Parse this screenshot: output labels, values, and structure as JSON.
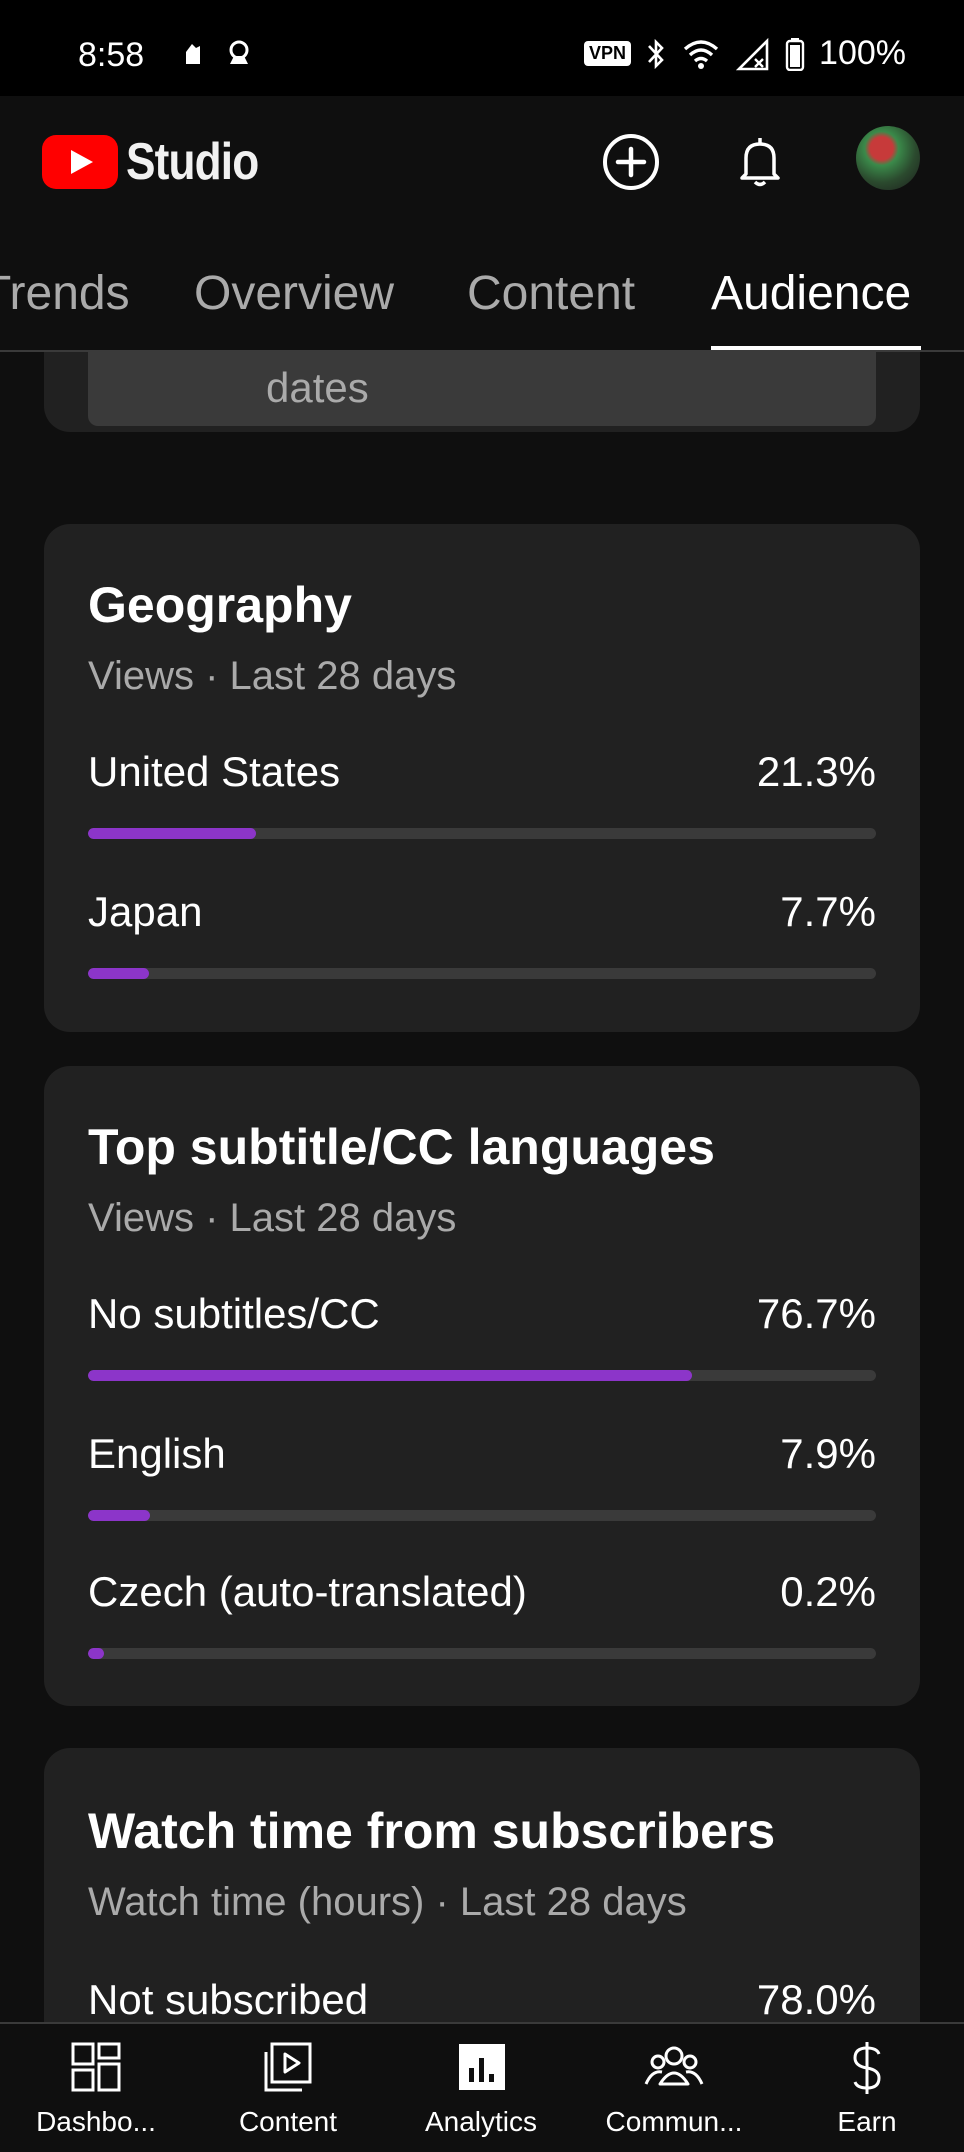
{
  "status_bar": {
    "time": "8:58",
    "vpn": "VPN",
    "battery": "100%"
  },
  "header": {
    "app_name": "Studio",
    "create_icon": "add-circle-icon",
    "notifications_icon": "bell-icon"
  },
  "tabs": [
    {
      "label": "Trends"
    },
    {
      "label": "Overview"
    },
    {
      "label": "Content"
    },
    {
      "label": "Audience",
      "active": true
    }
  ],
  "previous_card": {
    "partial_text": "dates"
  },
  "geography": {
    "title": "Geography",
    "subtitle": "Views · Last 28 days",
    "rows": [
      {
        "label": "United States",
        "value": "21.3%",
        "fraction": 0.213
      },
      {
        "label": "Japan",
        "value": "7.7%",
        "fraction": 0.077
      }
    ]
  },
  "subtitles": {
    "title": "Top subtitle/CC languages",
    "subtitle": "Views · Last 28 days",
    "rows": [
      {
        "label": "No subtitles/CC",
        "value": "76.7%",
        "fraction": 0.767
      },
      {
        "label": "English",
        "value": "7.9%",
        "fraction": 0.079
      },
      {
        "label": "Czech (auto-translated)",
        "value": "0.2%",
        "fraction": 0.02
      }
    ]
  },
  "subscribers": {
    "title": "Watch time from subscribers",
    "subtitle": "Watch time (hours) · Last 28 days",
    "rows": [
      {
        "label": "Not subscribed",
        "value": "78.0%"
      }
    ]
  },
  "bottom_nav": [
    {
      "label": "Dashbo...",
      "icon": "dashboard-icon"
    },
    {
      "label": "Content",
      "icon": "content-icon"
    },
    {
      "label": "Analytics",
      "icon": "analytics-icon",
      "active": true
    },
    {
      "label": "Commun...",
      "icon": "community-icon"
    },
    {
      "label": "Earn",
      "icon": "earn-icon"
    }
  ],
  "colors": {
    "accent": "#8c35c9",
    "brand_red": "#ff0000",
    "card_bg": "#212121",
    "page_bg": "#0f0f0f"
  }
}
